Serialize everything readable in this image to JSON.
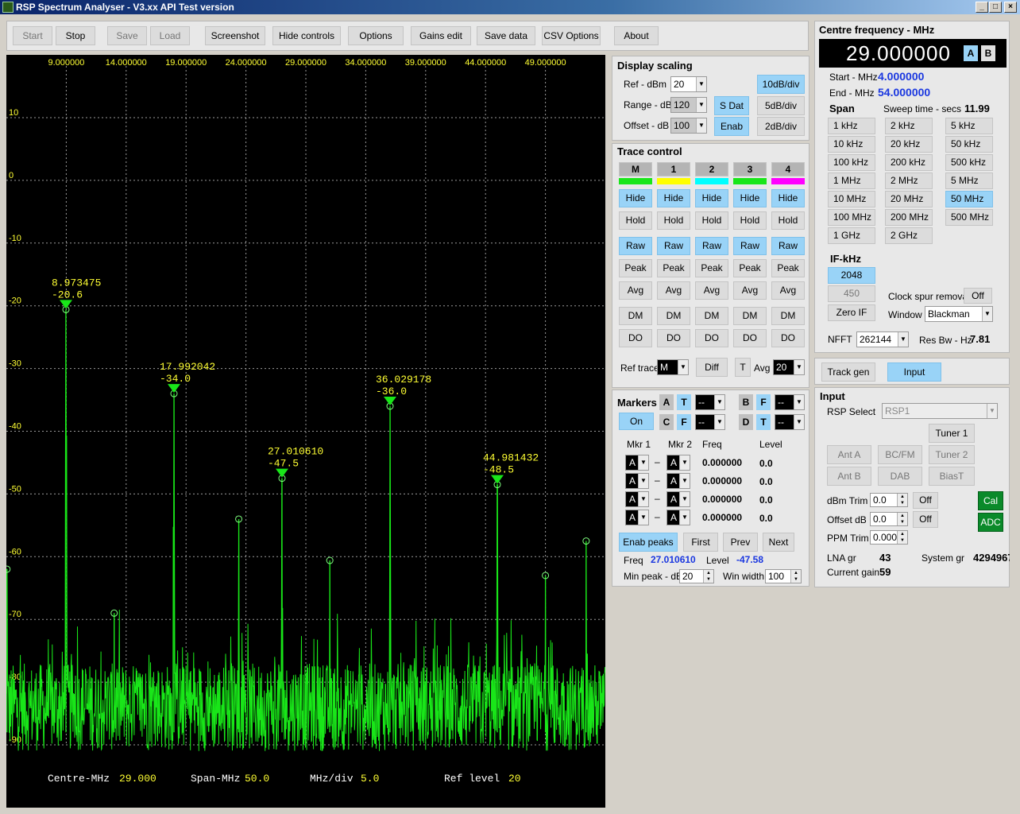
{
  "window": {
    "title": "RSP Spectrum Analyser - V3.xx API Test version",
    "min": "_",
    "max": "□",
    "close": "×"
  },
  "toolbar": [
    "Start",
    "Stop",
    "Save",
    "Load",
    "Screenshot",
    "Hide controls",
    "Options",
    "Gains edit",
    "Save data",
    "CSV Options",
    "About"
  ],
  "chart_data": {
    "type": "line",
    "x_tick_labels": [
      "9.000000",
      "14.000000",
      "19.000000",
      "24.000000",
      "29.000000",
      "34.000000",
      "39.000000",
      "44.000000",
      "49.000000"
    ],
    "y_tick_labels": [
      "10",
      "0",
      "-10",
      "-20",
      "-30",
      "-40",
      "-50",
      "-60",
      "-70",
      "-80",
      "-90"
    ],
    "x_ticks": [
      9,
      14,
      19,
      24,
      29,
      34,
      39,
      44,
      49
    ],
    "y_ticks": [
      10,
      0,
      -10,
      -20,
      -30,
      -40,
      -50,
      -60,
      -70,
      -80,
      -90
    ],
    "xlim": [
      4,
      54
    ],
    "ylim": [
      -100,
      20
    ],
    "series": [
      {
        "color": "#19e619",
        "peaks": [
          [
            8.973475,
            -20.6
          ],
          [
            17.992042,
            -34.0
          ],
          [
            27.01061,
            -47.5
          ],
          [
            36.029178,
            -36.0
          ],
          [
            44.981432,
            -48.5
          ],
          [
            4.05,
            -62.0
          ],
          [
            13.0,
            -69.0
          ],
          [
            23.4,
            -54.0
          ],
          [
            31.0,
            -60.6
          ],
          [
            49.0,
            -63.0
          ],
          [
            52.4,
            -57.5
          ]
        ],
        "noise_floor": -84
      }
    ],
    "markers": [
      {
        "freq": "8.973475",
        "level": "-20.6",
        "x": 8.973475,
        "y": -20.6
      },
      {
        "freq": "17.992042",
        "level": "-34.0",
        "x": 17.992042,
        "y": -34.0
      },
      {
        "freq": "27.010610",
        "level": "-47.5",
        "x": 27.01061,
        "y": -47.5
      },
      {
        "freq": "36.029178",
        "level": "-36.0",
        "x": 36.029178,
        "y": -36.0
      },
      {
        "freq": "44.981432",
        "level": "-48.5",
        "x": 44.981432,
        "y": -48.5
      }
    ],
    "circles": [
      [
        4.05,
        -62.0
      ],
      [
        13.0,
        -69.0
      ],
      [
        23.4,
        -54.0
      ],
      [
        31.0,
        -60.6
      ],
      [
        49.0,
        -63.0
      ],
      [
        52.4,
        -57.5
      ],
      [
        8.973475,
        -20.6
      ],
      [
        17.992042,
        -34.0
      ],
      [
        27.01061,
        -47.5
      ],
      [
        36.029178,
        -36.0
      ],
      [
        44.981432,
        -48.5
      ]
    ],
    "footer": {
      "centre_label": "Centre-MHz",
      "centre_value": "29.000",
      "span_label": "Span-MHz",
      "span_value": "50.0",
      "div_label": "MHz/div",
      "div_value": "5.0",
      "ref_label": "Ref level",
      "ref_value": "20"
    },
    "grid": true
  },
  "display_scaling": {
    "title": "Display scaling",
    "ref_label": "Ref - dBm",
    "ref_value": "20",
    "range_label": "Range - dB",
    "range_value": "120",
    "offset_label": "Offset - dB",
    "offset_value": "100",
    "sdat": "S Dat",
    "enab": "Enab",
    "div10": "10dB/div",
    "div5": "5dB/div",
    "div2": "2dB/div"
  },
  "trace_control": {
    "title": "Trace control",
    "traces": [
      {
        "label": "M",
        "color": "#19e619"
      },
      {
        "label": "1",
        "color": "#ffff00"
      },
      {
        "label": "2",
        "color": "#00ffff"
      },
      {
        "label": "3",
        "color": "#19e619"
      },
      {
        "label": "4",
        "color": "#ff00ff"
      }
    ],
    "rows": [
      "Hide",
      "Hold",
      "Raw",
      "Peak",
      "Avg",
      "DM",
      "DO"
    ],
    "ref_trace_label": "Ref trace",
    "ref_trace_value": "M",
    "diff": "Diff",
    "t": "T",
    "avg_label": "Avg",
    "avg_value": "20"
  },
  "markers": {
    "title": "Markers",
    "a": "A",
    "t": "T",
    "b": "B",
    "f": "F",
    "c": "C",
    "d": "D",
    "dash": "--",
    "on": "On",
    "col_mkr1": "Mkr 1",
    "col_mkr2": "Mkr 2",
    "col_freq": "Freq",
    "col_level": "Level",
    "rows": [
      {
        "m1": "A",
        "m2": "A",
        "freq": "0.000000",
        "level": "0.0"
      },
      {
        "m1": "A",
        "m2": "A",
        "freq": "0.000000",
        "level": "0.0"
      },
      {
        "m1": "A",
        "m2": "A",
        "freq": "0.000000",
        "level": "0.0"
      },
      {
        "m1": "A",
        "m2": "A",
        "freq": "0.000000",
        "level": "0.0"
      }
    ],
    "enab_peaks": "Enab peaks",
    "first": "First",
    "prev": "Prev",
    "next": "Next",
    "freq_label": "Freq",
    "freq_value": "27.010610",
    "level_label": "Level",
    "level_value": "-47.58",
    "minpeak_label": "Min peak - dB",
    "minpeak_value": "20",
    "winwidth_label": "Win width",
    "winwidth_value": "100"
  },
  "centre": {
    "title": "Centre frequency - MHz",
    "value": "29.000000",
    "a": "A",
    "b": "B",
    "start_label": "Start - MHz",
    "start_value": "4.000000",
    "end_label": "End - MHz",
    "end_value": "54.000000",
    "span_label": "Span",
    "sweep_label": "Sweep time - secs",
    "sweep_value": "11.99",
    "span_buttons": [
      "1 kHz",
      "2 kHz",
      "5 kHz",
      "10 kHz",
      "20 kHz",
      "50 kHz",
      "100 kHz",
      "200 kHz",
      "500 kHz",
      "1 MHz",
      "2 MHz",
      "5 MHz",
      "10 MHz",
      "20 MHz",
      "50 MHz",
      "100 MHz",
      "200 MHz",
      "500 MHz",
      "1 GHz",
      "2 GHz"
    ],
    "span_selected": "50 MHz",
    "if_label": "IF-kHz",
    "if_2048": "2048",
    "if_450": "450",
    "zero_if": "Zero IF",
    "clock_label": "Clock spur removal",
    "clock_value": "Off",
    "window_label": "Window",
    "window_value": "Blackman",
    "nfft_label": "NFFT",
    "nfft_value": "262144",
    "resbw_label": "Res Bw - Hz",
    "resbw_value": "7.81"
  },
  "tabs": {
    "track_gen": "Track gen",
    "input": "Input"
  },
  "input": {
    "title": "Input",
    "rsp_label": "RSP Select",
    "rsp_value": "RSP1",
    "tuner1": "Tuner 1",
    "tuner2": "Tuner 2",
    "ant_a": "Ant A",
    "bcfm": "BC/FM",
    "ant_b": "Ant B",
    "dab": "DAB",
    "biast": "BiasT",
    "dbm_trim_label": "dBm Trim",
    "dbm_trim_value": "0.0",
    "off1": "Off",
    "offset_label": "Offset dB",
    "offset_value": "0.0",
    "off2": "Off",
    "ppm_label": "PPM Trim",
    "ppm_value": "0.000",
    "cal": "Cal",
    "adc": "ADC",
    "lna_label": "LNA gr",
    "lna_value": "43",
    "sysgr_label": "System gr",
    "sysgr_value": "4294967",
    "curgain_label": "Current gain",
    "curgain_value": "59"
  }
}
